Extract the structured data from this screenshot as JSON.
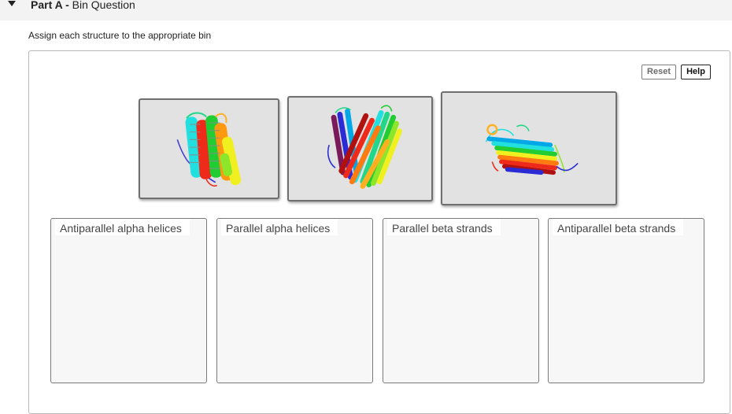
{
  "part": {
    "label": "Part A -",
    "title": "Bin Question",
    "caret_icon": "caret-down-icon"
  },
  "instruction": "Assign each structure to the appropriate bin",
  "toolbar": {
    "reset_label": "Reset",
    "help_label": "Help"
  },
  "structures": [
    {
      "name": "structure-card-helix-bundle",
      "depiction": "rainbow ribbon helix bundle"
    },
    {
      "name": "structure-card-beta-barrel",
      "depiction": "rainbow ribbon beta barrel"
    },
    {
      "name": "structure-card-beta-sheet",
      "depiction": "rainbow ribbon beta sheet"
    }
  ],
  "bins": [
    {
      "label": "Antiparallel alpha helices"
    },
    {
      "label": "Parallel alpha helices"
    },
    {
      "label": "Parallel beta strands"
    },
    {
      "label": "Antiparallel beta strands"
    }
  ],
  "colors": {
    "header_bg": "#f3f3f3",
    "card_bg": "#e2e2e2",
    "card_border": "#6f6f6f",
    "bin_bg": "#f7f7f8",
    "bin_border": "#7a7a7a",
    "ribbon_palette": [
      "#2b2bd6",
      "#00a8e8",
      "#22e0e0",
      "#22d68a",
      "#22cc33",
      "#8ee62a",
      "#f0f020",
      "#ffb020",
      "#ff7a10",
      "#ee2a1a",
      "#b01010",
      "#7a1a5a"
    ]
  }
}
